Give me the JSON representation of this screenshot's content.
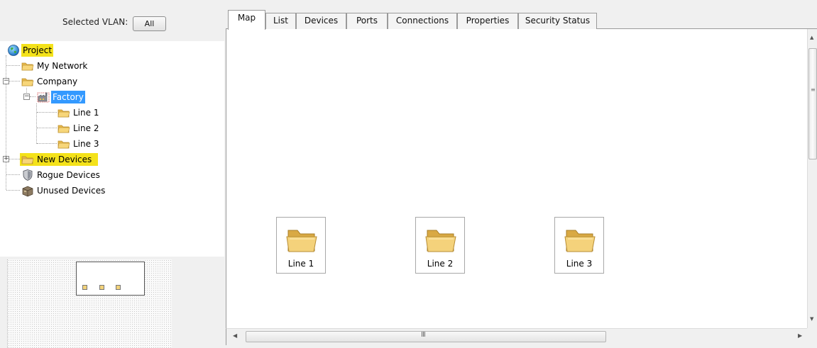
{
  "vlan": {
    "label": "Selected VLAN:",
    "button": "All"
  },
  "tree": {
    "project": "Project",
    "my_network": "My Network",
    "company": "Company",
    "factory": "Factory",
    "line1": "Line 1",
    "line2": "Line 2",
    "line3": "Line 3",
    "new_devices": "New Devices",
    "rogue_devices": "Rogue Devices",
    "unused_devices": "Unused Devices"
  },
  "tabs": [
    "Map",
    "List",
    "Devices",
    "Ports",
    "Connections",
    "Properties",
    "Security Status"
  ],
  "active_tab": "Map",
  "map_nodes": [
    "Line 1",
    "Line 2",
    "Line 3"
  ],
  "scrollbar": {
    "grip_glyph": "III"
  },
  "colors": {
    "highlight_yellow": "#f4e21a",
    "selection_blue": "#3399ff",
    "folder": "#f2cf6b"
  },
  "icons": {
    "project": "globe-icon",
    "folder": "folder-icon",
    "factory": "factory-icon",
    "rogue": "shield-icon",
    "unused": "device-box-icon"
  }
}
